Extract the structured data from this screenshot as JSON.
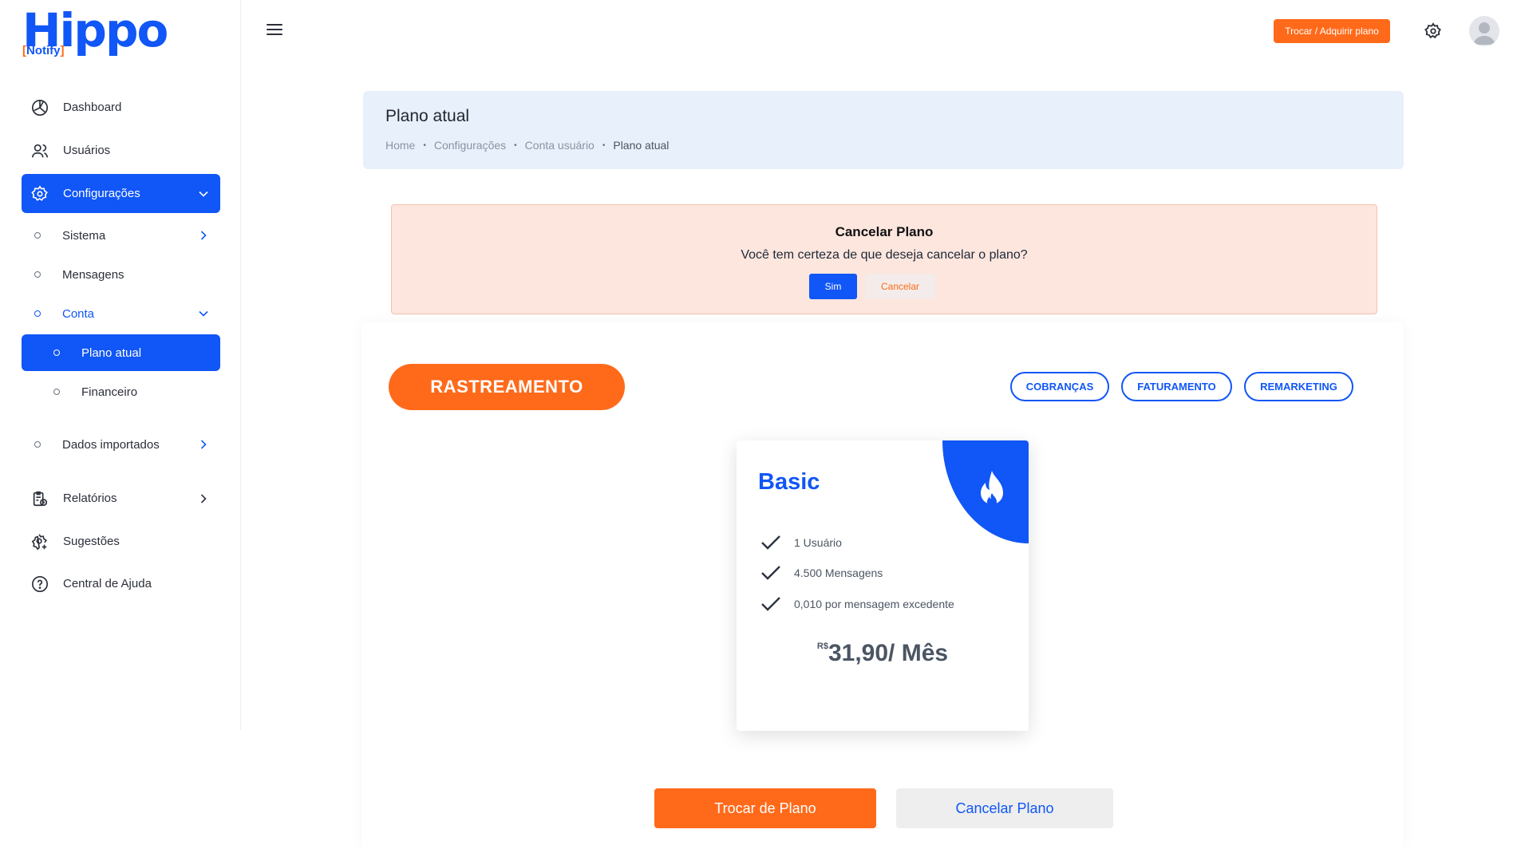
{
  "brand": {
    "logo_word": "Hippo",
    "logo_sub_open": "[",
    "logo_sub_word": "Notify",
    "logo_sub_close": "]",
    "primary": "#1156f6",
    "accent": "#ff6a1a"
  },
  "sidebar": {
    "items": [
      {
        "label": "Dashboard",
        "icon": "dashboard-icon"
      },
      {
        "label": "Usuários",
        "icon": "users-icon"
      },
      {
        "label": "Configurações",
        "icon": "settings-icon"
      },
      {
        "label": "Relatórios",
        "icon": "reports-icon"
      },
      {
        "label": "Sugestões",
        "icon": "suggestions-icon"
      },
      {
        "label": "Central de Ajuda",
        "icon": "help-icon"
      }
    ],
    "config_sub": [
      {
        "label": "Sistema"
      },
      {
        "label": "Mensagens"
      },
      {
        "label": "Conta"
      },
      {
        "label": "Dados importados"
      }
    ],
    "conta_sub": [
      {
        "label": "Plano atual"
      },
      {
        "label": "Financeiro"
      }
    ]
  },
  "topbar": {
    "change_plan_label": "Trocar / Adquirir plano"
  },
  "page": {
    "title": "Plano atual",
    "breadcrumb": [
      "Home",
      "Configurações",
      "Conta usuário",
      "Plano atual"
    ]
  },
  "alert": {
    "title": "Cancelar Plano",
    "message": "Você tem certeza de que deseja cancelar o plano?",
    "yes_label": "Sim",
    "no_label": "Cancelar"
  },
  "plans": {
    "current_category": "RASTREAMENTO",
    "other_categories": [
      "COBRANÇAS",
      "FATURAMENTO",
      "REMARKETING"
    ]
  },
  "plan_card": {
    "name": "Basic",
    "features": [
      "1 Usuário",
      "4.500 Mensagens",
      "0,010 por mensagem excedente"
    ],
    "currency": "R$",
    "price": "31,90/ Mês"
  },
  "actions": {
    "change_label": "Trocar de Plano",
    "cancel_label": "Cancelar Plano"
  }
}
